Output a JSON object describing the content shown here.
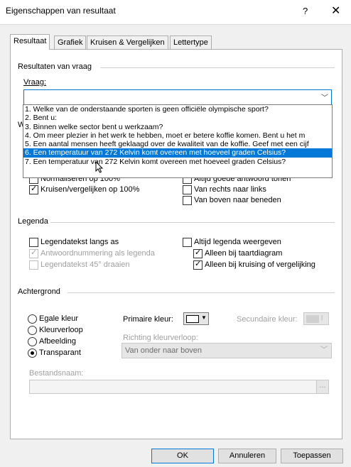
{
  "window": {
    "title": "Eigenschappen van resultaat",
    "help": "?",
    "close": "✕"
  },
  "tabs": [
    "Resultaat",
    "Grafiek",
    "Kruisen & Vergelijken",
    "Lettertype"
  ],
  "resultaten": {
    "group": "Resultaten van vraag",
    "vraag_label": "Vraag:",
    "combo_value": "",
    "options": [
      "1. Welke van de onderstaande sporten is geen officiële olympische sport?",
      "2. Bent u:",
      "3. Binnen welke sector bent u werkzaam?",
      "4. Om meer plezier in het werk te hebben, moet er betere koffie komen. Bent u het m",
      "5. Een aantal mensen heeft geklaagd over de kwaliteit van de koffie. Geef met een cijf",
      "6. Een temperatuur van 272 Kelvin komt overeen met hoeveel graden Celsius?",
      "7. Een temperatuur van 272 Kelvin komt overeen met hoeveel graden Celsius?"
    ],
    "selected_index": 5
  },
  "weergave": {
    "group_partial": "W",
    "normaliseren_partial": "Normaliseren op 100%",
    "kruisen": "Kruisen/vergelijken op 100%",
    "altijd_goede_partial": "Altijd goede antwoord tonen",
    "rechts_links": "Van rechts naar links",
    "boven_beneden": "Van boven naar beneden"
  },
  "legenda": {
    "group": "Legenda",
    "langs_as": "Legendatekst langs as",
    "antwoordnummering": "Antwoordnummering als legenda",
    "draaien": "Legendatekst 45° draaien",
    "altijd": "Altijd legenda weergeven",
    "taartdiagram": "Alleen bij taartdiagram",
    "kruising": "Alleen bij kruising of vergelijking"
  },
  "achtergrond": {
    "group": "Achtergrond",
    "radios": [
      "Egale kleur",
      "Kleurverloop",
      "Afbeelding",
      "Transparant"
    ],
    "selected": 3,
    "primaire": "Primaire kleur:",
    "secundaire": "Secundaire kleur:",
    "richting": "Richting kleurverloop:",
    "richting_value": "Van onder naar boven",
    "bestandsnaam": "Bestandsnaam:",
    "browse": "..."
  },
  "buttons": {
    "ok": "OK",
    "annuleren": "Annuleren",
    "toepassen": "Toepassen"
  },
  "colors": {
    "accent": "#0078d7",
    "panel": "#ffffff",
    "dialog": "#f0f0f0"
  }
}
